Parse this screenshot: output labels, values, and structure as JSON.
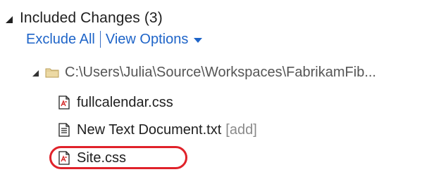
{
  "section": {
    "title": "Included Changes (3)"
  },
  "actions": {
    "exclude_all": "Exclude All",
    "view_options": "View Options"
  },
  "folder": {
    "path": "C:\\Users\\Julia\\Source\\Workspaces\\FabrikamFib..."
  },
  "files": [
    {
      "name": "fullcalendar.css",
      "tag": "",
      "icon": "css-file-icon"
    },
    {
      "name": "New Text Document.txt",
      "tag": "[add]",
      "icon": "text-file-icon"
    },
    {
      "name": "Site.css",
      "tag": "",
      "icon": "css-file-icon"
    }
  ],
  "colors": {
    "link": "#1e64c8",
    "highlight": "#e0222a",
    "tag": "#8a8a8a"
  }
}
